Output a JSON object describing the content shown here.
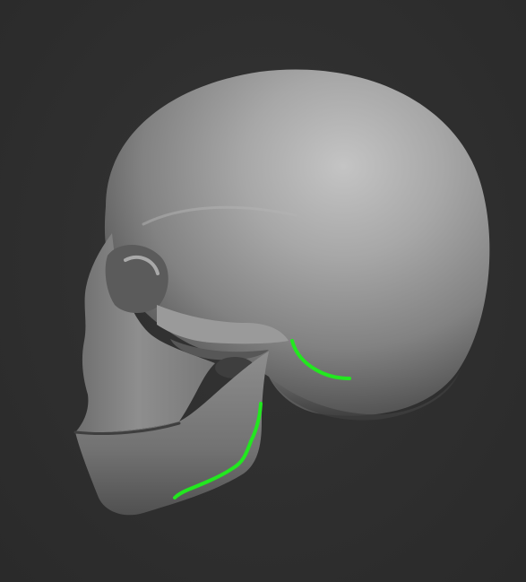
{
  "viewport": {
    "background_color": "#2f2f2f"
  },
  "model": {
    "subject": "skull",
    "view": "left lateral",
    "material_color": "#8a8a8a",
    "highlight_color": "#c9c9c9",
    "shadow_color": "#3b3b3b"
  },
  "annotations": {
    "stroke_color": "#22e81f",
    "strokes": [
      {
        "name": "mastoid-curve"
      },
      {
        "name": "jaw-ramus-curve"
      }
    ]
  }
}
